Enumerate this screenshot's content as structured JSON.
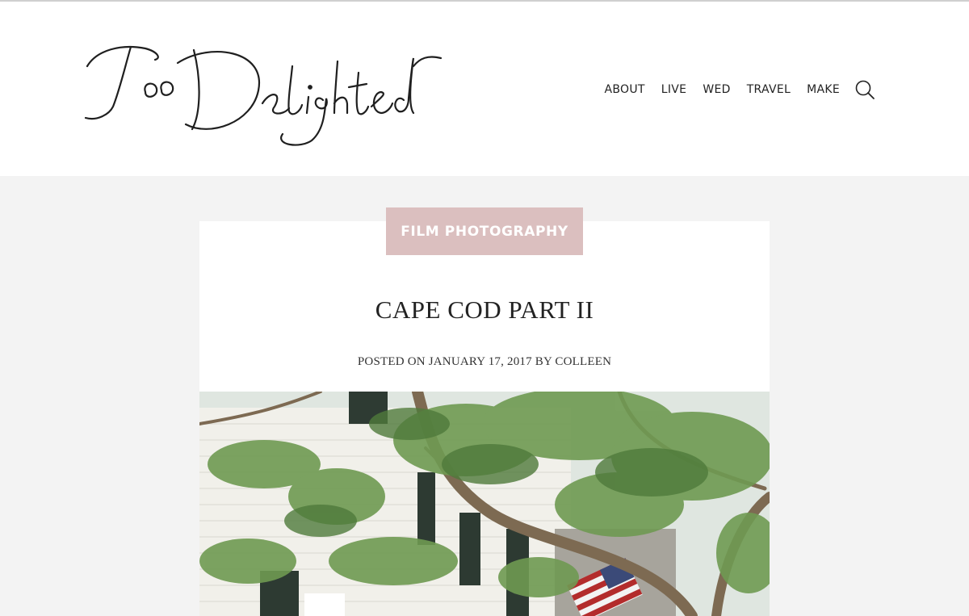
{
  "site": {
    "logo_text": "Too Delighted"
  },
  "nav": {
    "items": [
      "ABOUT",
      "LIVE",
      "WED",
      "TRAVEL",
      "MAKE"
    ],
    "search_icon": "search-icon"
  },
  "post": {
    "category": "FILM PHOTOGRAPHY",
    "title": "CAPE COD PART II",
    "posted_prefix": "POSTED ON",
    "date": "JANUARY 17, 2017",
    "by": "BY",
    "author": "COLLEEN"
  },
  "colors": {
    "badge": "#dbbfbf",
    "page_bg": "#f3f3f3"
  }
}
